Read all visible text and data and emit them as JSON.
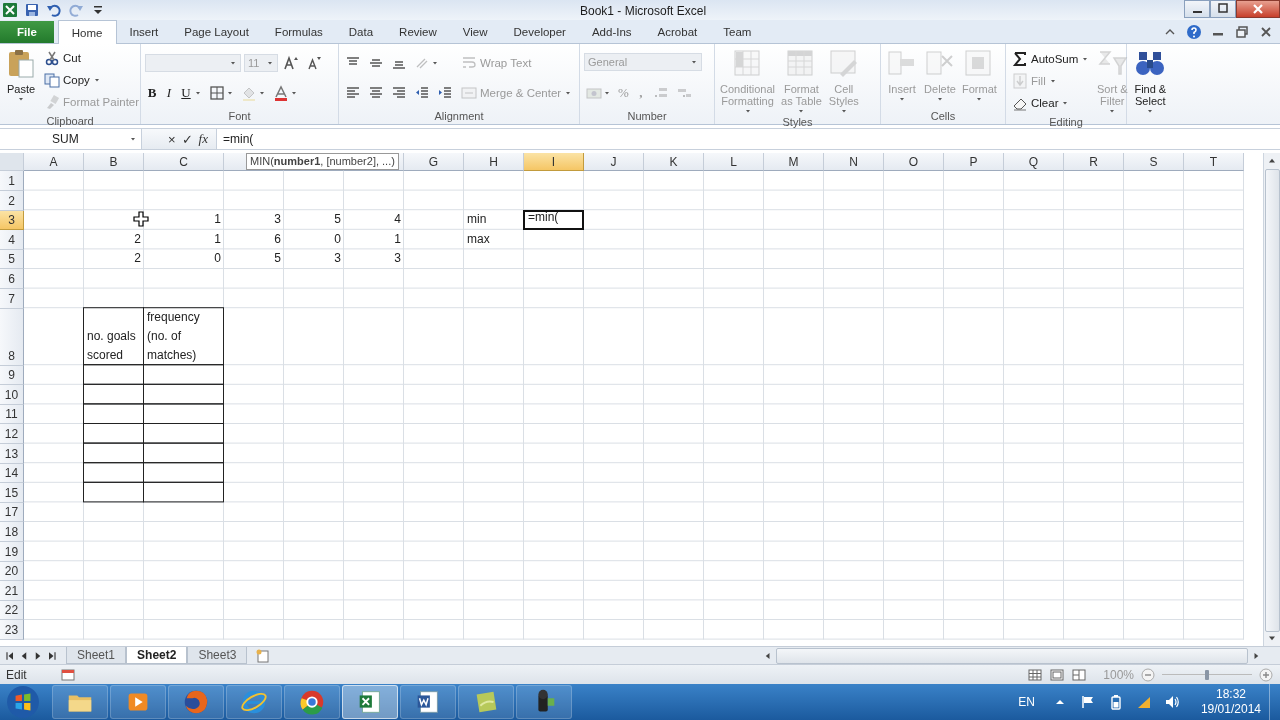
{
  "window": {
    "title": "Book1 - Microsoft Excel",
    "quick_access": [
      {
        "kind": "save",
        "disabled": false
      },
      {
        "kind": "undo",
        "disabled": false
      },
      {
        "kind": "redo",
        "disabled": true
      },
      {
        "kind": "customize",
        "disabled": false
      }
    ]
  },
  "tabs": [
    {
      "label": "File",
      "kind": "file",
      "selected": false
    },
    {
      "label": "Home",
      "kind": "tab",
      "selected": true
    },
    {
      "label": "Insert",
      "kind": "tab",
      "selected": false
    },
    {
      "label": "Page Layout",
      "kind": "tab",
      "selected": false
    },
    {
      "label": "Formulas",
      "kind": "tab",
      "selected": false
    },
    {
      "label": "Data",
      "kind": "tab",
      "selected": false
    },
    {
      "label": "Review",
      "kind": "tab",
      "selected": false
    },
    {
      "label": "View",
      "kind": "tab",
      "selected": false
    },
    {
      "label": "Developer",
      "kind": "tab",
      "selected": false
    },
    {
      "label": "Add-Ins",
      "kind": "tab",
      "selected": false
    },
    {
      "label": "Acrobat",
      "kind": "tab",
      "selected": false
    },
    {
      "label": "Team",
      "kind": "tab",
      "selected": false
    }
  ],
  "ribbon": {
    "groups": [
      {
        "label": "Clipboard",
        "blocks": [
          {
            "kind": "paste",
            "lines": [
              "Paste"
            ],
            "caret": true,
            "disabled": false
          },
          {
            "rows": [
              [
                {
                  "kind": "cut",
                  "label": "Cut",
                  "caret": false,
                  "disabled": false
                }
              ],
              [
                {
                  "kind": "copy",
                  "label": "Copy",
                  "caret": true,
                  "disabled": false
                }
              ],
              [
                {
                  "kind": "brush",
                  "label": "Format Painter",
                  "caret": false,
                  "disabled": true
                }
              ]
            ]
          }
        ]
      },
      {
        "label": "Font",
        "blocks": [
          {
            "rows": [
              [
                {
                  "kind": "font_combo",
                  "disabled": true
                },
                {
                  "kind": "size_combo",
                  "label": "11",
                  "disabled": true
                },
                {
                  "kind": "grow",
                  "caret": false,
                  "disabled": false
                },
                {
                  "kind": "shrink",
                  "caret": false,
                  "disabled": false
                }
              ],
              [
                {
                  "kind": "bold",
                  "label": "B",
                  "caret": false,
                  "disabled": false
                },
                {
                  "kind": "italic",
                  "label": "I",
                  "caret": false,
                  "disabled": false
                },
                {
                  "kind": "underline",
                  "label": "U",
                  "caret": true,
                  "disabled": false
                },
                {
                  "kind": "borders",
                  "caret": true,
                  "disabled": false
                },
                {
                  "kind": "fill",
                  "caret": true,
                  "disabled": true
                },
                {
                  "kind": "fontcolor",
                  "caret": true,
                  "disabled": false
                }
              ]
            ]
          }
        ]
      },
      {
        "label": "Alignment",
        "blocks": [
          {
            "rows": [
              [
                {
                  "kind": "top",
                  "caret": false,
                  "disabled": false
                },
                {
                  "kind": "middle",
                  "caret": false,
                  "disabled": false
                },
                {
                  "kind": "bottom",
                  "caret": false,
                  "disabled": false
                },
                {
                  "kind": "orient",
                  "caret": true,
                  "disabled": true
                }
              ],
              [
                {
                  "kind": "left",
                  "caret": false,
                  "disabled": false
                },
                {
                  "kind": "center",
                  "caret": false,
                  "disabled": false
                },
                {
                  "kind": "right",
                  "caret": false,
                  "disabled": false
                },
                {
                  "kind": "outdent",
                  "caret": false,
                  "disabled": false
                },
                {
                  "kind": "indent",
                  "caret": false,
                  "disabled": false
                }
              ]
            ]
          },
          {
            "rows": [
              [
                {
                  "kind": "wrap",
                  "label": "Wrap Text",
                  "caret": false,
                  "disabled": true
                }
              ],
              [
                {
                  "kind": "merge",
                  "label": "Merge & Center",
                  "caret": true,
                  "disabled": true
                }
              ]
            ]
          }
        ]
      },
      {
        "label": "Number",
        "blocks": [
          {
            "rows": [
              [
                {
                  "kind": "number_format",
                  "label": "General",
                  "disabled": true
                }
              ],
              [
                {
                  "kind": "currency",
                  "caret": true,
                  "disabled": true
                },
                {
                  "kind": "percent",
                  "label": "%",
                  "caret": false,
                  "disabled": true
                },
                {
                  "kind": "comma",
                  "label": ",",
                  "caret": false,
                  "disabled": true
                },
                {
                  "kind": "incdec",
                  "caret": false,
                  "disabled": true
                },
                {
                  "kind": "decdec",
                  "caret": false,
                  "disabled": true
                }
              ]
            ]
          }
        ]
      },
      {
        "label": "Styles",
        "blocks": [
          {
            "kind": "condfmt",
            "lines": [
              "Conditional",
              "Formatting"
            ],
            "caret": true,
            "disabled": true
          },
          {
            "kind": "table",
            "lines": [
              "Format",
              "as Table"
            ],
            "caret": true,
            "disabled": true
          },
          {
            "kind": "cellstyles",
            "lines": [
              "Cell",
              "Styles"
            ],
            "caret": true,
            "disabled": true
          }
        ]
      },
      {
        "label": "Cells",
        "blocks": [
          {
            "kind": "insert",
            "lines": [
              "Insert"
            ],
            "caret": true,
            "disabled": true
          },
          {
            "kind": "delete",
            "lines": [
              "Delete"
            ],
            "caret": true,
            "disabled": true
          },
          {
            "kind": "format",
            "lines": [
              "Format"
            ],
            "caret": true,
            "disabled": true
          }
        ]
      },
      {
        "label": "Editing",
        "blocks": [
          {
            "rows": [
              [
                {
                  "kind": "sum",
                  "label": "AutoSum",
                  "caret": true,
                  "disabled": false
                }
              ],
              [
                {
                  "kind": "filldown",
                  "label": "Fill",
                  "caret": true,
                  "disabled": true
                }
              ],
              [
                {
                  "kind": "eraser",
                  "label": "Clear",
                  "caret": true,
                  "disabled": false
                }
              ]
            ]
          },
          {
            "kind": "sort",
            "lines": [
              "Sort &",
              "Filter"
            ],
            "caret": true,
            "disabled": true
          },
          {
            "kind": "find",
            "lines": [
              "Find &",
              "Select"
            ],
            "caret": true,
            "disabled": false
          }
        ]
      }
    ]
  },
  "formula_bar": {
    "name_box": "SUM",
    "cancel": "×",
    "enter": "✓",
    "function_button": "fx",
    "formula": "=min("
  },
  "tooltip": "MIN(**number1**, [number2], ...)",
  "sheet": {
    "columns": [
      {
        "label": "A",
        "selected": false
      },
      {
        "label": "B",
        "selected": false
      },
      {
        "label": "C",
        "selected": false
      },
      {
        "selected": false
      },
      {
        "selected": false
      },
      {
        "selected": false
      },
      {
        "label": "G",
        "selected": false
      },
      {
        "label": "H",
        "selected": false
      },
      {
        "label": "I",
        "selected": true
      },
      {
        "label": "J",
        "selected": false
      },
      {
        "label": "K",
        "selected": false
      },
      {
        "label": "L",
        "selected": false
      },
      {
        "label": "M",
        "selected": false
      },
      {
        "label": "N",
        "selected": false
      },
      {
        "label": "O",
        "selected": false
      },
      {
        "label": "P",
        "selected": false
      },
      {
        "label": "Q",
        "selected": false
      },
      {
        "label": "R",
        "selected": false
      },
      {
        "label": "S",
        "selected": false
      },
      {
        "label": "T",
        "selected": false
      }
    ],
    "rows": [
      {
        "label": "1",
        "selected": false,
        "cells": []
      },
      {
        "label": "2",
        "selected": false,
        "cells": []
      },
      {
        "label": "3",
        "selected": true,
        "cells": [
          null,
          null,
          {
            "text": "1",
            "kind": "number"
          },
          {
            "text": "3",
            "kind": "number"
          },
          {
            "text": "5",
            "kind": "number"
          },
          {
            "text": "4",
            "kind": "number"
          },
          null,
          {
            "text": "min",
            "kind": "text"
          },
          {
            "text": "=min(",
            "kind": "text"
          }
        ]
      },
      {
        "label": "4",
        "selected": false,
        "cells": [
          null,
          {
            "text": "2",
            "kind": "number"
          },
          {
            "text": "1",
            "kind": "number"
          },
          {
            "text": "6",
            "kind": "number"
          },
          {
            "text": "0",
            "kind": "number"
          },
          {
            "text": "1",
            "kind": "number"
          },
          null,
          {
            "text": "max",
            "kind": "text"
          }
        ]
      },
      {
        "label": "5",
        "selected": false,
        "cells": [
          null,
          {
            "text": "2",
            "kind": "number"
          },
          {
            "text": "0",
            "kind": "number"
          },
          {
            "text": "5",
            "kind": "number"
          },
          {
            "text": "3",
            "kind": "number"
          },
          {
            "text": "3",
            "kind": "number"
          }
        ]
      },
      {
        "label": "6",
        "selected": false,
        "cells": []
      },
      {
        "label": "7",
        "selected": false,
        "cells": []
      },
      {
        "label": "8",
        "selected": false,
        "cells": [
          null,
          {
            "text": "no. goals scored",
            "kind": "text",
            "boxed": true
          },
          {
            "text": "frequency (no. of matches)",
            "kind": "text",
            "boxed": true
          }
        ]
      },
      {
        "label": "9",
        "selected": false,
        "cells": [
          null,
          {
            "boxed": true
          },
          {
            "boxed": true
          }
        ]
      },
      {
        "label": "10",
        "selected": false,
        "cells": [
          null,
          {
            "boxed": true
          },
          {
            "boxed": true
          }
        ]
      },
      {
        "label": "11",
        "selected": false,
        "cells": [
          null,
          {
            "boxed": true
          },
          {
            "boxed": true
          }
        ]
      },
      {
        "label": "12",
        "selected": false,
        "cells": [
          null,
          {
            "boxed": true
          },
          {
            "boxed": true
          }
        ]
      },
      {
        "label": "13",
        "selected": false,
        "cells": [
          null,
          {
            "boxed": true
          },
          {
            "boxed": true
          }
        ]
      },
      {
        "label": "14",
        "selected": false,
        "cells": [
          null,
          {
            "boxed": true
          },
          {
            "boxed": true
          }
        ]
      },
      {
        "label": "15",
        "selected": false,
        "cells": [
          null,
          {
            "boxed": true
          },
          {
            "boxed": true
          }
        ]
      },
      {
        "label": "17",
        "selected": false,
        "cells": []
      },
      {
        "label": "18",
        "selected": false,
        "cells": []
      },
      {
        "label": "19",
        "selected": false,
        "cells": []
      },
      {
        "label": "20",
        "selected": false,
        "cells": []
      },
      {
        "label": "21",
        "selected": false,
        "cells": []
      },
      {
        "label": "22",
        "selected": false,
        "cells": []
      },
      {
        "label": "23",
        "selected": false,
        "cells": []
      }
    ]
  },
  "sheet_tabs": [
    {
      "label": "Sheet1",
      "selected": false
    },
    {
      "label": "Sheet2",
      "selected": true
    },
    {
      "label": "Sheet3",
      "selected": false
    }
  ],
  "status_bar": {
    "mode": "Edit",
    "zoom": "100%",
    "zoom_slider": {
      "level": 0.5
    }
  },
  "taskbar": {
    "apps": [
      {
        "kind": "folder",
        "active": false
      },
      {
        "kind": "media",
        "active": false
      },
      {
        "kind": "firefox",
        "active": false
      },
      {
        "kind": "ie",
        "active": false
      },
      {
        "kind": "chrome",
        "active": false
      },
      {
        "kind": "spreadsheet",
        "active": true
      },
      {
        "kind": "document",
        "active": false
      },
      {
        "kind": "notes",
        "active": false
      },
      {
        "kind": "camera",
        "active": false
      }
    ],
    "language": "EN",
    "time": "18:32",
    "date": "19/01/2014"
  }
}
